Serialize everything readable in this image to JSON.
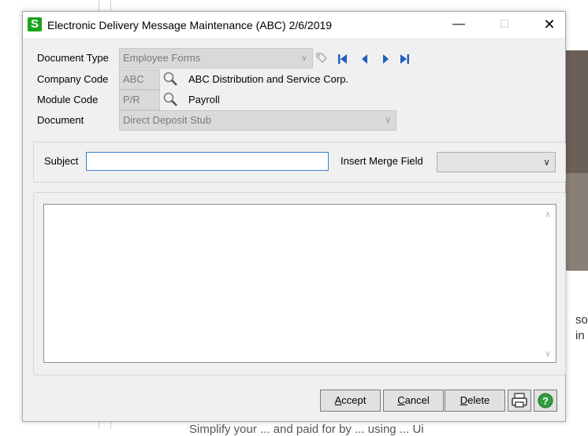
{
  "window": {
    "app_icon_letter": "S",
    "title": "Electronic Delivery Message Maintenance (ABC) 2/6/2019",
    "minimize": "—",
    "maximize": "□",
    "close": "✕"
  },
  "form": {
    "document_type": {
      "label": "Document Type",
      "value": "Employee Forms"
    },
    "company_code": {
      "label": "Company Code",
      "value": "ABC",
      "description": "ABC Distribution and Service Corp."
    },
    "module_code": {
      "label": "Module Code",
      "value": "P/R",
      "description": "Payroll"
    },
    "document": {
      "label": "Document",
      "value": "Direct Deposit Stub"
    }
  },
  "subject": {
    "label": "Subject",
    "value": ""
  },
  "merge_field": {
    "label": "Insert Merge Field",
    "value": ""
  },
  "body_text": "",
  "buttons": {
    "accept_u": "A",
    "accept_rest": "ccept",
    "cancel_u": "C",
    "cancel_rest": "ancel",
    "delete_u": "D",
    "delete_rest": "elete"
  },
  "background": {
    "text1": "so",
    "text2": "in",
    "bottom_text": "Simplify your ... and paid for by ... using ... Ui"
  },
  "colors": {
    "nav_blue": "#1f5fbf",
    "app_icon_green": "#1aa31a",
    "help_green": "#2e9e3e"
  },
  "icons": [
    "lookup-icon",
    "tag-icon",
    "first-record-icon",
    "previous-record-icon",
    "next-record-icon",
    "last-record-icon",
    "printer-icon",
    "help-icon"
  ]
}
